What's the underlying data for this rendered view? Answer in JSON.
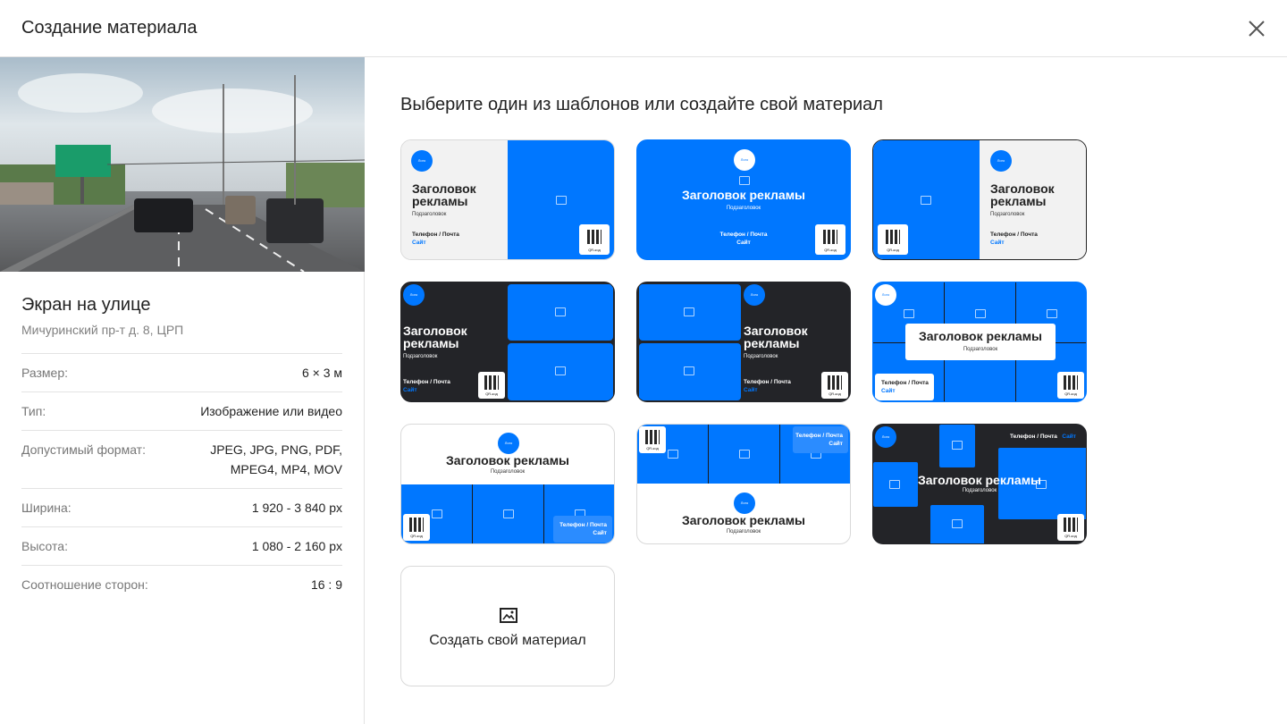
{
  "modal": {
    "title": "Создание материала"
  },
  "location": {
    "name": "Экран на улице",
    "address": "Мичуринский пр-т д. 8, ЦРП",
    "specs": [
      {
        "key": "Размер:",
        "value": "6 × 3 м"
      },
      {
        "key": "Тип:",
        "value": "Изображение или видео"
      },
      {
        "key": "Допустимый формат:",
        "value": "JPEG, JPG, PNG, PDF, MPEG4, MP4, MOV"
      },
      {
        "key": "Ширина:",
        "value": "1 920 - 3 840 px"
      },
      {
        "key": "Высота:",
        "value": "1 080 - 2 160 px"
      },
      {
        "key": "Соотношение сторон:",
        "value": "16 : 9"
      }
    ]
  },
  "templates": {
    "heading": "Выберите один из шаблонов или создайте свой материал",
    "ad_title": "Заголовок рекламы",
    "ad_subtitle": "Подзаголовок",
    "contact": "Телефон / Почта",
    "site": "Сайт",
    "qr": "QR-код",
    "logo": "Лого",
    "create_label": "Создать свой материал"
  },
  "colors": {
    "accent": "#0077ff",
    "dark": "#232428",
    "light": "#f2f2f2"
  },
  "icons": {
    "close": "close-icon",
    "image": "image-icon"
  }
}
